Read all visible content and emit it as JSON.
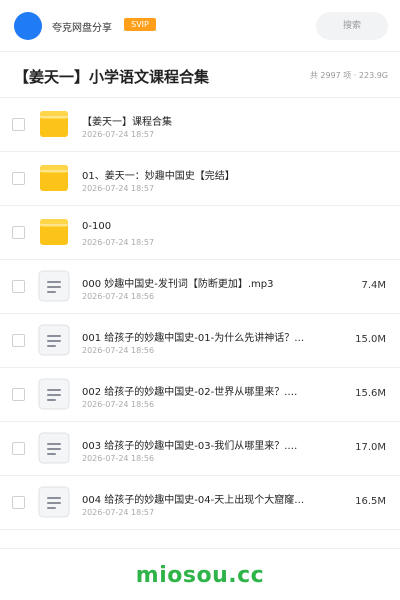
{
  "header": {
    "user_name": "夸克网盘分享",
    "badge": "SVIP",
    "search_placeholder": "搜索",
    "avatar_color": "#1f7cf5",
    "badge_color": "#ff9f1a"
  },
  "folder": {
    "title": "【姜天一】小学语文课程合集",
    "stats": "共 2997 项 · 223.9G"
  },
  "items": [
    {
      "type": "folder",
      "icon": "folder-icon",
      "name": "【姜天一】课程合集",
      "date": "2026-07-24 18:57",
      "size": ""
    },
    {
      "type": "folder",
      "icon": "folder-icon",
      "name": "01、姜天一：妙趣中国史【完结】",
      "date": "2026-07-24 18:57",
      "size": ""
    },
    {
      "type": "folder",
      "icon": "folder-icon",
      "name": "0-100",
      "date": "2026-07-24 18:57",
      "size": ""
    },
    {
      "type": "file",
      "icon": "document-icon",
      "name": "000 妙趣中国史-发刊词【防断更加】.mp3",
      "date": "2026-07-24 18:56",
      "size": "7.4M"
    },
    {
      "type": "file",
      "icon": "document-icon",
      "name": "001 给孩子的妙趣中国史-01-为什么先讲神话？…",
      "date": "2026-07-24 18:56",
      "size": "15.0M"
    },
    {
      "type": "file",
      "icon": "document-icon",
      "name": "002 给孩子的妙趣中国史-02-世界从哪里来？.…",
      "date": "2026-07-24 18:56",
      "size": "15.6M"
    },
    {
      "type": "file",
      "icon": "document-icon",
      "name": "003 给孩子的妙趣中国史-03-我们从哪里来？.…",
      "date": "2026-07-24 18:56",
      "size": "17.0M"
    },
    {
      "type": "file",
      "icon": "document-icon",
      "name": "004 给孩子的妙趣中国史-04-天上出现个大窟窿…",
      "date": "2026-07-24 18:57",
      "size": "16.5M"
    }
  ],
  "footer": {
    "watermark": "miosou.cc",
    "watermark_color": "#2fb44a"
  }
}
